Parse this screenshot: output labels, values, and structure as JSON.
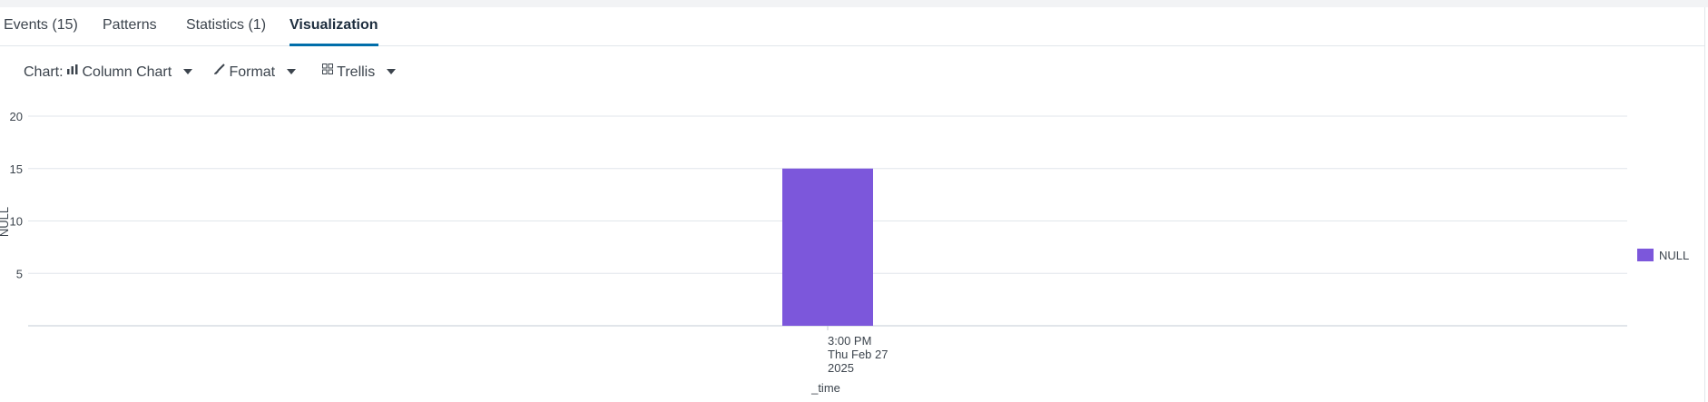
{
  "tabs": [
    {
      "label": "Events (15)",
      "active": false
    },
    {
      "label": "Patterns",
      "active": false
    },
    {
      "label": "Statistics (1)",
      "active": false
    },
    {
      "label": "Visualization",
      "active": true
    }
  ],
  "toolbar": {
    "chart_prefix": "Chart:",
    "chart_label": "Column Chart",
    "format_label": "Format",
    "trellis_label": "Trellis"
  },
  "colors": {
    "series": "#7c57db",
    "gridline": "#e1e6eb",
    "tab_underline": "#006eaa"
  },
  "chart_data": {
    "type": "bar",
    "categories": [
      "3:00 PM\nThu Feb 27\n2025"
    ],
    "series": [
      {
        "name": "NULL",
        "values": [
          15
        ],
        "color": "#7c57db"
      }
    ],
    "xlabel": "_time",
    "ylabel": "NULL",
    "ylim": [
      0,
      20
    ],
    "yticks": [
      5,
      10,
      15,
      20
    ],
    "grid": true,
    "legend": "right"
  }
}
